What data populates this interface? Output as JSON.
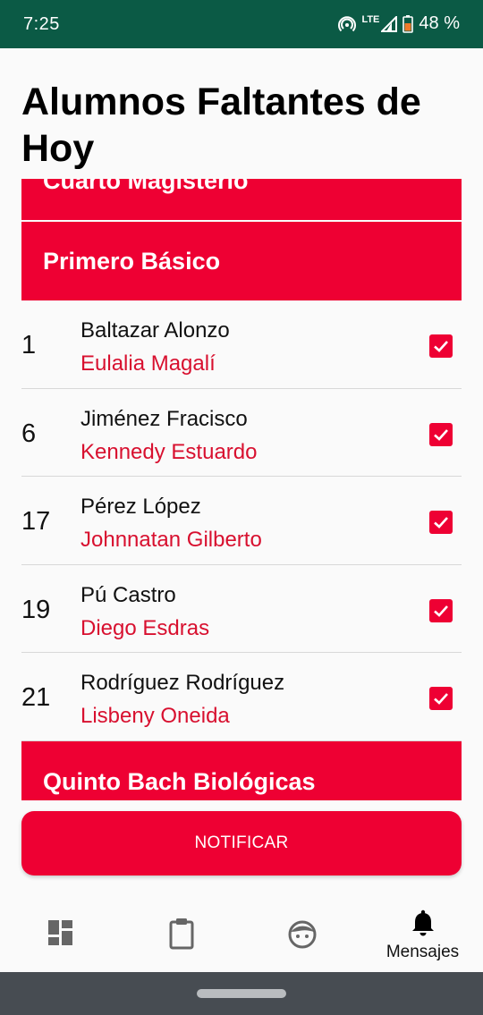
{
  "status_bar": {
    "time": "7:25",
    "network": "LTE",
    "battery": "48 %"
  },
  "page_title": "Alumnos Faltantes de Hoy",
  "sections": [
    {
      "label": "Cuarto Magisterio"
    },
    {
      "label": "Primero Básico"
    },
    {
      "label": "Quinto Bach Biológicas"
    }
  ],
  "students": [
    {
      "number": "1",
      "last_name": "Baltazar Alonzo",
      "first_name": "Eulalia Magalí",
      "checked": true
    },
    {
      "number": "6",
      "last_name": "Jiménez Fracisco",
      "first_name": "Kennedy Estuardo",
      "checked": true
    },
    {
      "number": "17",
      "last_name": "Pérez López",
      "first_name": "Johnnatan Gilberto",
      "checked": true
    },
    {
      "number": "19",
      "last_name": "Pú Castro",
      "first_name": "Diego Esdras",
      "checked": true
    },
    {
      "number": "21",
      "last_name": "Rodríguez Rodríguez",
      "first_name": "Lisbeny Oneida",
      "checked": true
    }
  ],
  "notify_button": {
    "label": "NOTIFICAR"
  },
  "bottom_nav": {
    "items": [
      {
        "icon": "dashboard-icon",
        "label": ""
      },
      {
        "icon": "clipboard-icon",
        "label": ""
      },
      {
        "icon": "face-icon",
        "label": ""
      },
      {
        "icon": "bell-icon",
        "label": "Mensajes"
      }
    ]
  },
  "colors": {
    "accent": "#ee0033",
    "status_bar": "#0b5a45",
    "first_name": "#d8102f"
  }
}
